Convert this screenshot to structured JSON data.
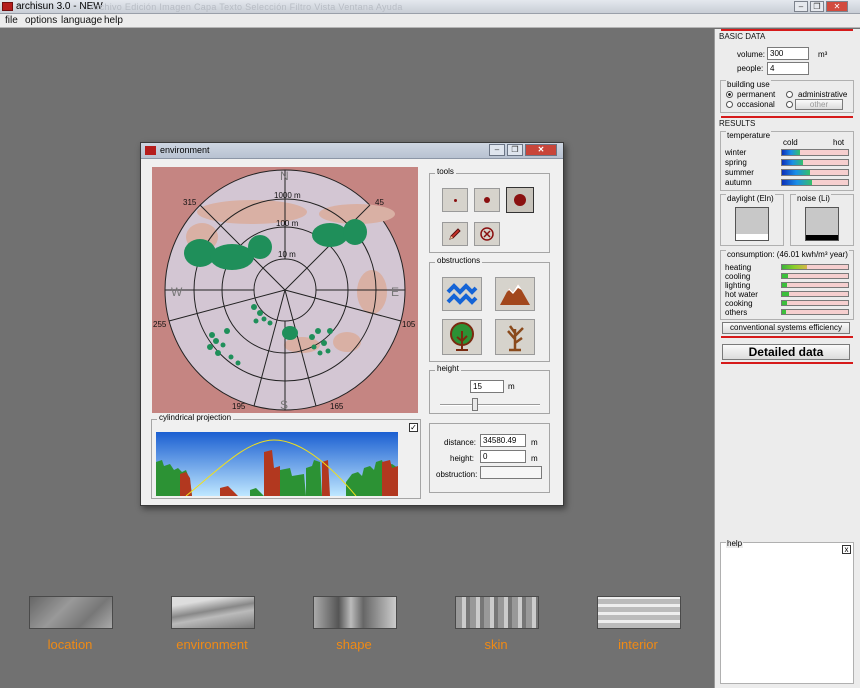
{
  "app": {
    "title": "archisun 3.0 - NEW",
    "ghost_menu": "Archivo   Edición   Imagen   Capa   Texto   Selección   Filtro   Vista   Ventana   Ayuda"
  },
  "menu": [
    "file",
    "options",
    "language",
    "help"
  ],
  "dialog": {
    "title": "environment",
    "polar": {
      "north": "N",
      "south": "S",
      "east": "E",
      "west": "W",
      "deg_315": "315",
      "deg_45": "45",
      "deg_255": "255",
      "deg_105": "105",
      "deg_195": "195",
      "deg_165": "165",
      "ring_1000": "1000 m",
      "ring_100": "100 m",
      "ring_10": "10 m"
    },
    "tools_label": "tools",
    "obstructions_label": "obstructions",
    "height_label": "height",
    "height_value": "15",
    "height_unit": "m",
    "height_slider": 0.35,
    "cylindrical_label": "cylindrical projection",
    "cylindrical_checked": true,
    "distance_label": "distance:",
    "distance_value": "34580.49",
    "distance_unit": "m",
    "info_height_label": "height:",
    "info_height_value": "0",
    "info_height_unit": "m",
    "obstruction_label": "obstruction:",
    "obstruction_value": ""
  },
  "side": {
    "basic_data": "BASIC DATA",
    "volume_label": "volume:",
    "volume_value": "300",
    "volume_unit": "m³",
    "people_label": "people:",
    "people_value": "4",
    "building_use": "building use",
    "permanent": "permanent",
    "administrative": "administrative",
    "occasional": "occasional",
    "other": "other",
    "selected_use": "permanent",
    "results": "RESULTS",
    "temperature": "temperature",
    "cold": "cold",
    "hot": "hot",
    "seasons": [
      {
        "label": "winter",
        "level": 0.27
      },
      {
        "label": "spring",
        "level": 0.32
      },
      {
        "label": "summer",
        "level": 0.43
      },
      {
        "label": "autumn",
        "level": 0.45
      }
    ],
    "daylight": "daylight (Eln)",
    "noise": "noise (Li)",
    "daylight_level": 0.18,
    "noise_level": 0.15,
    "consumption": "consumption: (46.01 kwh/m³ year)",
    "consumption_items": [
      {
        "label": "heating",
        "level": 0.38
      },
      {
        "label": "cooling",
        "level": 0.09
      },
      {
        "label": "lighting",
        "level": 0.07
      },
      {
        "label": "hot water",
        "level": 0.11
      },
      {
        "label": "cooking",
        "level": 0.08
      },
      {
        "label": "others",
        "level": 0.06
      }
    ],
    "conv_btn": "conventional systems efficiency",
    "detailed_btn": "Detailed data",
    "help": "help",
    "help_close": "x"
  },
  "nav": [
    "location",
    "environment",
    "shape",
    "skin",
    "interior"
  ],
  "colors": {
    "accent_red": "#d61a1a",
    "nav_orange": "#f08a14",
    "obstruction_green": "#1f8f5a",
    "cloud": "#d9b0a4"
  }
}
